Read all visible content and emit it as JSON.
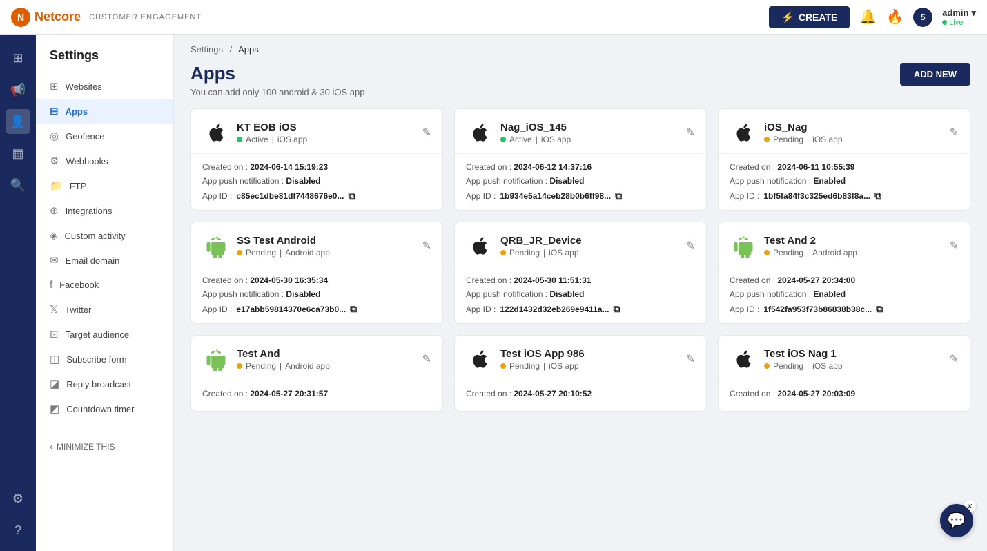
{
  "topnav": {
    "logo_letter": "N",
    "brand": "Netcore",
    "subtitle": "CUSTOMER ENGAGEMENT",
    "create_label": "CREATE",
    "admin_name": "admin",
    "admin_arrow": "▾",
    "live_label": "Live"
  },
  "breadcrumb": {
    "settings_label": "Settings",
    "separator": "/",
    "current": "Apps"
  },
  "page": {
    "title": "Apps",
    "subtitle": "You can add only 100 android & 30 iOS app",
    "add_new_label": "ADD NEW"
  },
  "sidebar": {
    "title": "Settings",
    "items": [
      {
        "id": "websites",
        "label": "Websites",
        "icon": "⊞"
      },
      {
        "id": "apps",
        "label": "Apps",
        "icon": "⊟"
      },
      {
        "id": "geofence",
        "label": "Geofence",
        "icon": "◎"
      },
      {
        "id": "webhooks",
        "label": "Webhooks",
        "icon": "⚙"
      },
      {
        "id": "ftp",
        "label": "FTP",
        "icon": "📁"
      },
      {
        "id": "integrations",
        "label": "Integrations",
        "icon": "⊕"
      },
      {
        "id": "custom-activity",
        "label": "Custom activity",
        "icon": "◈"
      },
      {
        "id": "email-domain",
        "label": "Email domain",
        "icon": "✉"
      },
      {
        "id": "facebook",
        "label": "Facebook",
        "icon": "f"
      },
      {
        "id": "twitter",
        "label": "Twitter",
        "icon": "𝕏"
      },
      {
        "id": "target-audience",
        "label": "Target audience",
        "icon": "⊡"
      },
      {
        "id": "subscribe-form",
        "label": "Subscribe form",
        "icon": "◫"
      },
      {
        "id": "reply-broadcast",
        "label": "Reply broadcast",
        "icon": "◪"
      },
      {
        "id": "countdown-timer",
        "label": "Countdown timer",
        "icon": "◩"
      }
    ],
    "minimize_label": "MINIMIZE THIS"
  },
  "rail_icons": [
    {
      "id": "home",
      "icon": "⊞",
      "active": false
    },
    {
      "id": "megaphone",
      "icon": "📢",
      "active": false
    },
    {
      "id": "user",
      "icon": "👤",
      "active": false
    },
    {
      "id": "table",
      "icon": "▦",
      "active": false
    },
    {
      "id": "search",
      "icon": "🔍",
      "active": false
    }
  ],
  "apps": [
    {
      "name": "KT EOB iOS",
      "platform": "ios",
      "status": "Active",
      "status_type": "active",
      "app_type": "iOS app",
      "created_on": "2024-06-14 15:19:23",
      "push_notification": "Disabled",
      "app_id": "c85ec1dbe81df7448676e0..."
    },
    {
      "name": "Nag_iOS_145",
      "platform": "ios",
      "status": "Active",
      "status_type": "active",
      "app_type": "iOS app",
      "created_on": "2024-06-12 14:37:16",
      "push_notification": "Disabled",
      "app_id": "1b934e5a14ceb28b0b6ff98..."
    },
    {
      "name": "iOS_Nag",
      "platform": "ios",
      "status": "Pending",
      "status_type": "pending",
      "app_type": "iOS app",
      "created_on": "2024-06-11 10:55:39",
      "push_notification": "Enabled",
      "app_id": "1bf5fa84f3c325ed6b83f8a..."
    },
    {
      "name": "SS Test Android",
      "platform": "android",
      "status": "Pending",
      "status_type": "pending",
      "app_type": "Android app",
      "created_on": "2024-05-30 16:35:34",
      "push_notification": "Disabled",
      "app_id": "e17abb59814370e6ca73b0..."
    },
    {
      "name": "QRB_JR_Device",
      "platform": "ios",
      "status": "Pending",
      "status_type": "pending",
      "app_type": "iOS app",
      "created_on": "2024-05-30 11:51:31",
      "push_notification": "Disabled",
      "app_id": "122d1432d32eb269e9411a..."
    },
    {
      "name": "Test And 2",
      "platform": "android",
      "status": "Pending",
      "status_type": "pending",
      "app_type": "Android app",
      "created_on": "2024-05-27 20:34:00",
      "push_notification": "Enabled",
      "app_id": "1f542fa953f73b86838b38c..."
    },
    {
      "name": "Test And",
      "platform": "android",
      "status": "Pending",
      "status_type": "pending",
      "app_type": "Android app",
      "created_on": "2024-05-27 20:31:57",
      "push_notification": null,
      "app_id": null
    },
    {
      "name": "Test iOS App 986",
      "platform": "ios",
      "status": "Pending",
      "status_type": "pending",
      "app_type": "iOS app",
      "created_on": "2024-05-27 20:10:52",
      "push_notification": null,
      "app_id": null
    },
    {
      "name": "Test iOS Nag 1",
      "platform": "ios",
      "status": "Pending",
      "status_type": "pending",
      "app_type": "iOS app",
      "created_on": "2024-05-27 20:03:09",
      "push_notification": null,
      "app_id": null
    }
  ],
  "labels": {
    "created_on": "Created on :",
    "push_notif": "App push notification :",
    "app_id": "App ID :"
  },
  "colors": {
    "active_dot": "#22c55e",
    "pending_dot": "#f59e0b",
    "brand_dark": "#1a2a5e",
    "android_green": "#78c257"
  }
}
